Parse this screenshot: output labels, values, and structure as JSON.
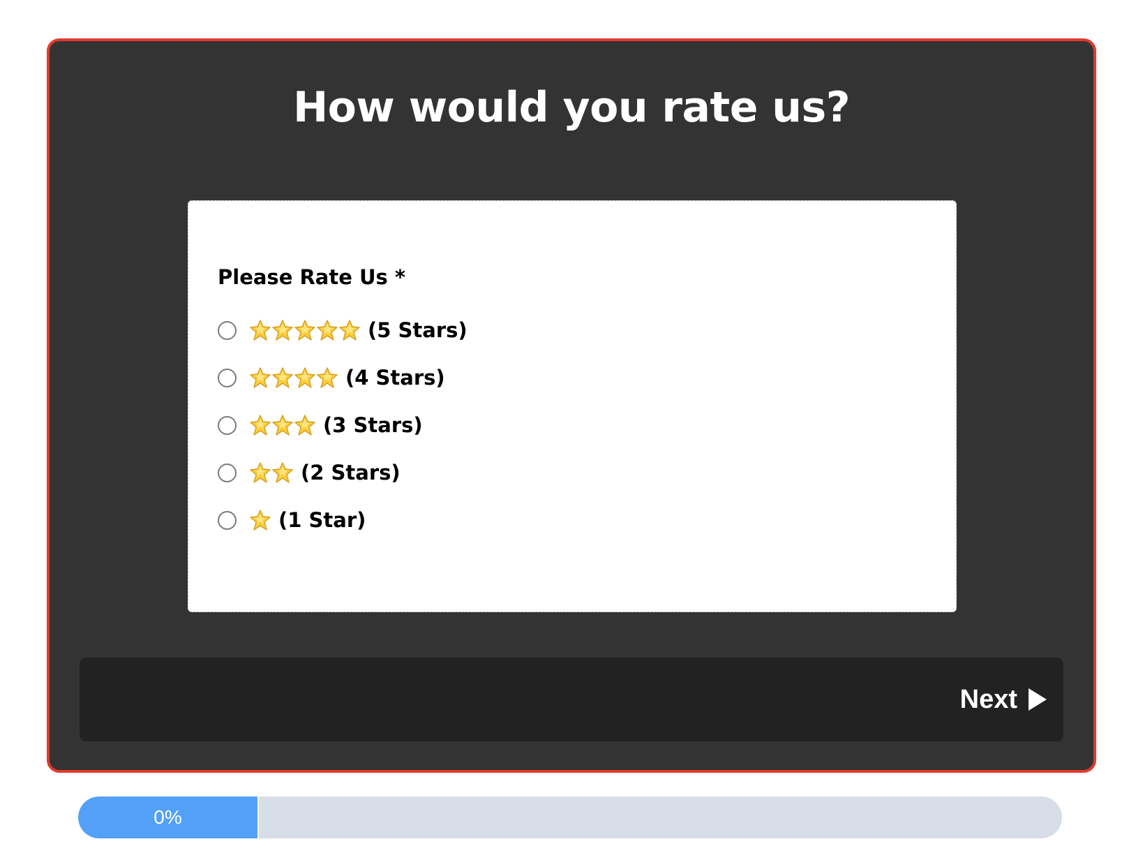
{
  "survey": {
    "title": "How would you rate us?",
    "question_label": "Please Rate Us *",
    "options": [
      {
        "label": "(5 Stars)",
        "stars": 5,
        "selected": false
      },
      {
        "label": "(4 Stars)",
        "stars": 4,
        "selected": false
      },
      {
        "label": "(3 Stars)",
        "stars": 3,
        "selected": false
      },
      {
        "label": "(2 Stars)",
        "stars": 2,
        "selected": false
      },
      {
        "label": "(1 Star)",
        "stars": 1,
        "selected": false
      }
    ],
    "next_label": "Next",
    "next_icon": "play-triangle-icon",
    "star_icon": "star-icon"
  },
  "progress": {
    "label": "0%",
    "value_percent": 0
  },
  "colors": {
    "card_background": "#333333",
    "card_border": "#e23a2c",
    "footer_background": "#222222",
    "progress_fill": "#53a0f8",
    "progress_track": "#d8dee8",
    "star_fill": "#f8cf3b"
  }
}
